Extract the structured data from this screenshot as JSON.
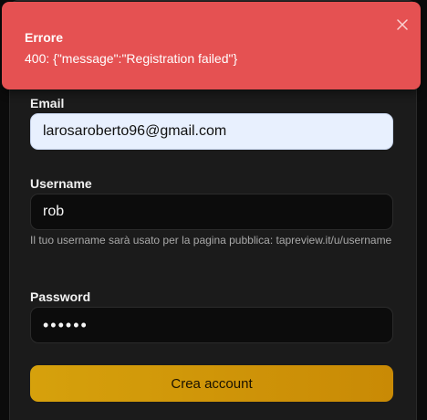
{
  "toast": {
    "title": "Errore",
    "message": "400: {\"message\":\"Registration failed\"}",
    "close_icon": "close-icon",
    "background": "#e55152"
  },
  "form": {
    "email": {
      "label": "Email",
      "value": "larosaroberto96@gmail.com"
    },
    "username": {
      "label": "Username",
      "value": "rob",
      "helper": "Il tuo username sarà usato per la pagina pubblica: tapreview.it/u/username"
    },
    "password": {
      "label": "Password",
      "value": "••••••"
    },
    "submit_label": "Crea account",
    "accent": "#d6a10c"
  }
}
